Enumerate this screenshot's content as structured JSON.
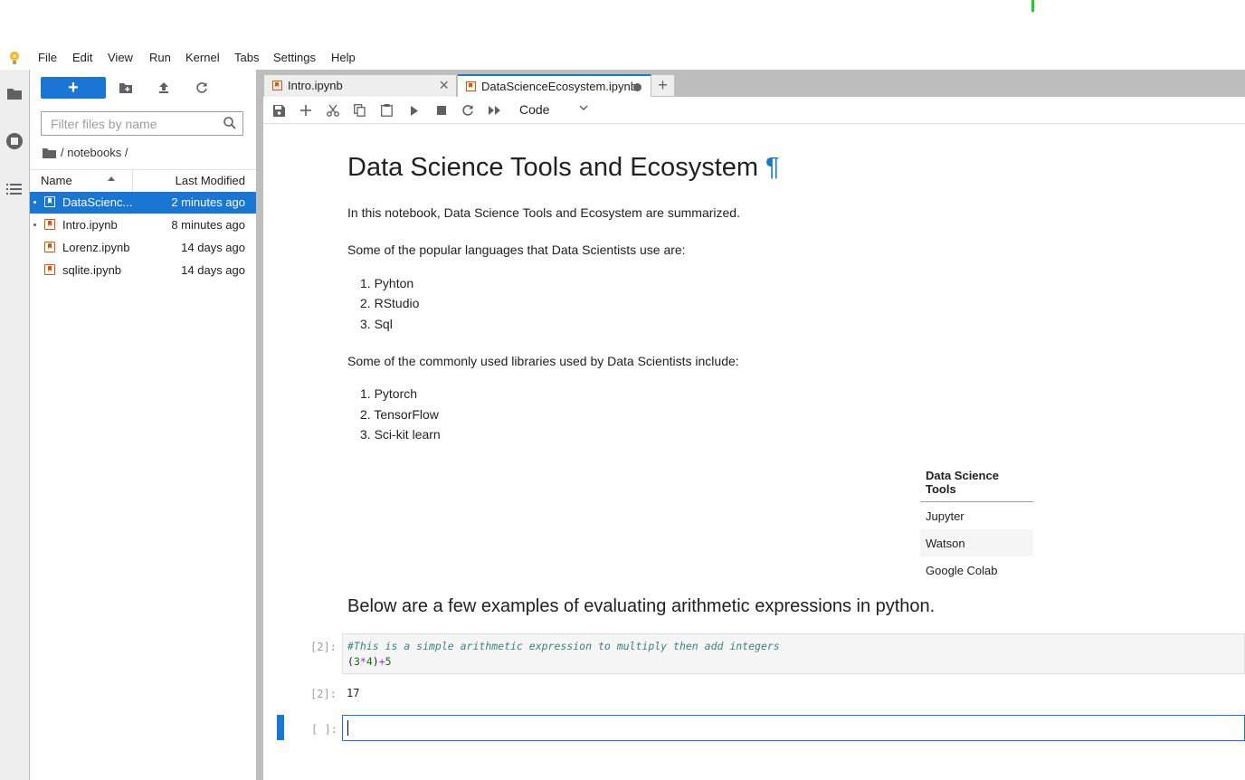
{
  "menubar": {
    "items": [
      "File",
      "Edit",
      "View",
      "Run",
      "Kernel",
      "Tabs",
      "Settings",
      "Help"
    ]
  },
  "icons": {
    "logo": "jupyter-logo-icon",
    "activity": [
      "folder-icon",
      "stop-circle-icon",
      "table-of-contents-icon"
    ],
    "filebrowser_toolbar": [
      "new-folder-icon",
      "upload-icon",
      "refresh-icon"
    ],
    "notebook_toolbar": [
      "save-icon",
      "add-cell-icon",
      "cut-icon",
      "copy-icon",
      "paste-icon",
      "run-icon",
      "stop-icon",
      "restart-icon",
      "fast-forward-icon"
    ]
  },
  "filebrowser": {
    "new_label": "+",
    "filter_placeholder": "Filter files by name",
    "breadcrumb": "/ notebooks /",
    "columns": {
      "name": "Name",
      "modified": "Last Modified"
    },
    "files": [
      {
        "name": "DataScienc...",
        "modified": "2 minutes ago",
        "selected": true,
        "running": true
      },
      {
        "name": "Intro.ipynb",
        "modified": "8 minutes ago",
        "selected": false,
        "running": true
      },
      {
        "name": "Lorenz.ipynb",
        "modified": "14 days ago",
        "selected": false,
        "running": false
      },
      {
        "name": "sqlite.ipynb",
        "modified": "14 days ago",
        "selected": false,
        "running": false
      }
    ]
  },
  "tabs": [
    {
      "label": "Intro.ipynb",
      "active": false
    },
    {
      "label": "DataScienceEcosystem.ipynb",
      "active": true,
      "dirty": true
    }
  ],
  "tab_add_label": "+",
  "toolbar": {
    "cell_type": "Code"
  },
  "notebook": {
    "title": "Data Science Tools and Ecosystem",
    "title_anchor": "¶",
    "intro": "In this notebook, Data Science Tools and Ecosystem are summarized.",
    "languages_heading": "Some of the popular languages that Data Scientists use are:",
    "languages": [
      "Pyhton",
      "RStudio",
      "Sql"
    ],
    "libraries_heading": "Some of the commonly used libraries used by Data Scientists include:",
    "libraries": [
      "Pytorch",
      "TensorFlow",
      "Sci-kit learn"
    ],
    "tools_table": {
      "header": "Data Science Tools",
      "rows": [
        "Jupyter",
        "Watson",
        "Google Colab"
      ]
    },
    "examples_heading": "Below are a few examples of evaluating arithmetic expressions in python.",
    "code_cell": {
      "prompt": "[2]:",
      "comment": "#This is a simple arithmetic expression to multiply then add integers",
      "code": "(3*4)+5",
      "output_prompt": "[2]:",
      "output": "17"
    },
    "empty_cell_prompt": "[ ]:"
  },
  "colors": {
    "accent": "#1976d2",
    "notebook_icon": "#e65100",
    "indicator": "#22cc22"
  }
}
